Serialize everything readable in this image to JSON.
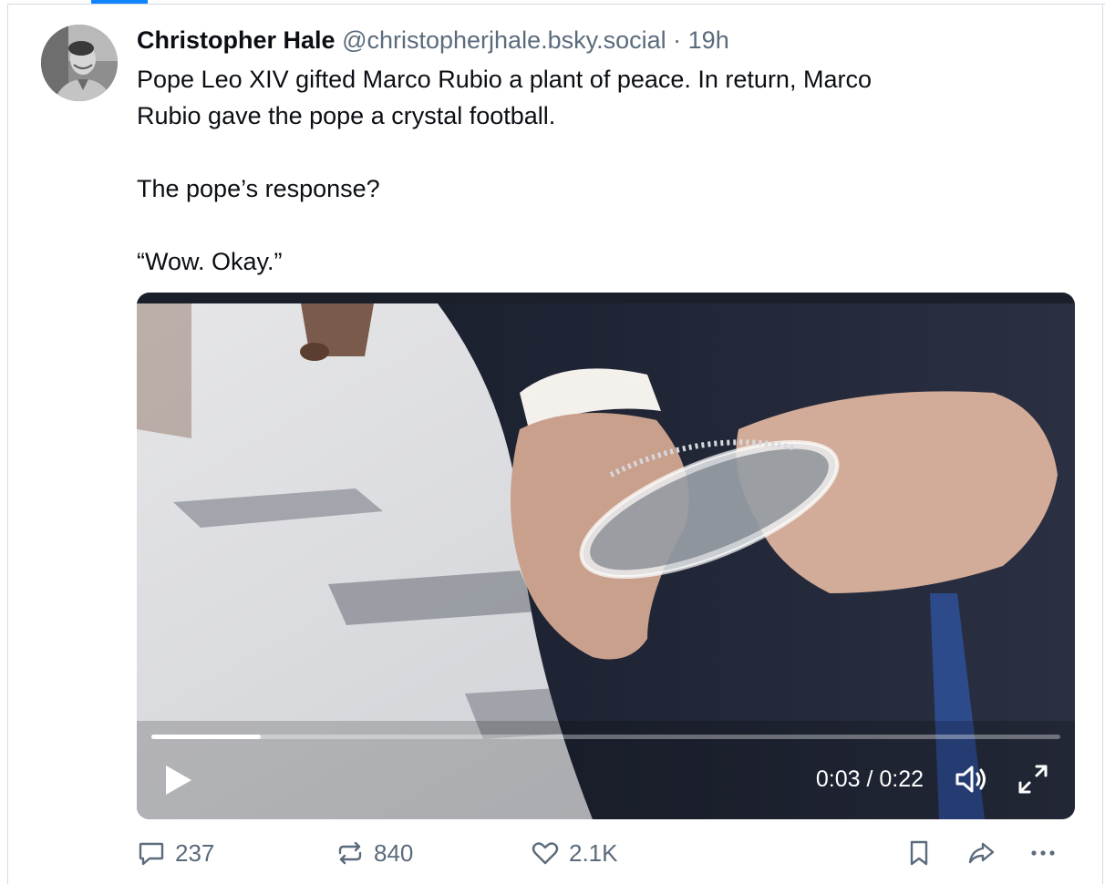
{
  "post": {
    "author_name": "Christopher Hale",
    "handle": "@christopherjhale.bsky.social",
    "separator": "·",
    "time": "19h",
    "text": "Pope Leo XIV gifted Marco Rubio a plant of peace. In return, Marco\nRubio gave the pope a crystal football.\n\nThe pope’s response?\n\n“Wow. Okay.”"
  },
  "video": {
    "current_time": "0:03",
    "duration": "0:22",
    "time_readout": "0:03 / 0:22",
    "progress_fraction": 0.12
  },
  "actions": {
    "replies": "237",
    "reposts": "840",
    "likes": "2.1K"
  },
  "icons": [
    "reply-icon",
    "repost-icon",
    "like-icon",
    "bookmark-icon",
    "share-icon",
    "more-icon",
    "play-icon",
    "volume-icon",
    "fullscreen-icon"
  ],
  "colors": {
    "accent": "#1083fe",
    "muted": "#5b6b7c",
    "text": "#0b0f14"
  }
}
